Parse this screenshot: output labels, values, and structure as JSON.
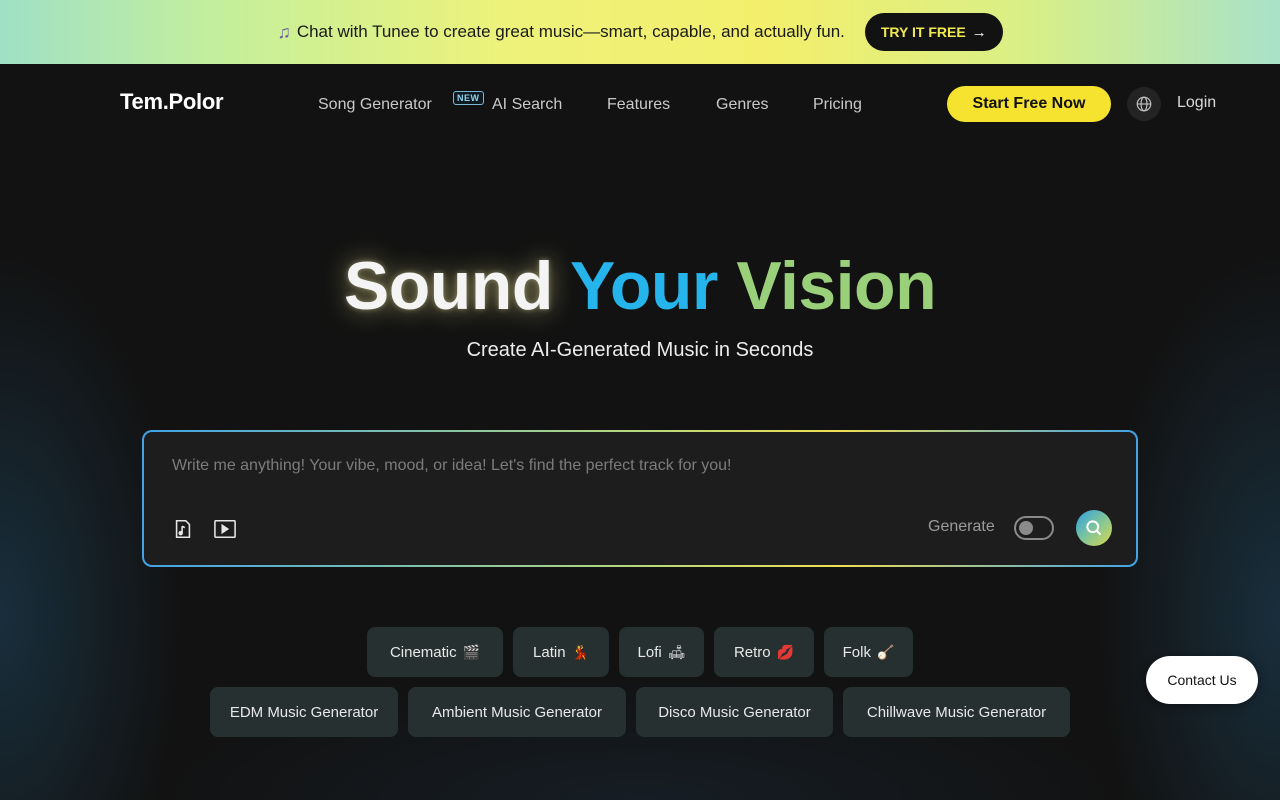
{
  "banner": {
    "text": "Chat with Tunee to create great music—smart, capable, and actually fun.",
    "cta": "TRY IT FREE",
    "arrow": "→"
  },
  "nav": {
    "logo": "Tem.Polor",
    "links": [
      "Song Generator",
      "AI Search",
      "Features",
      "Genres",
      "Pricing"
    ],
    "badge": "NEW",
    "start_label": "Start Free Now",
    "login_label": "Login"
  },
  "hero": {
    "title_part1": "Sound",
    "title_part2": "Your",
    "title_part3": "Vision",
    "subtitle": "Create AI-Generated Music in Seconds"
  },
  "prompt": {
    "placeholder": "Write me anything! Your vibe, mood, or idea! Let's find the perfect track for you!",
    "generate_label": "Generate",
    "generate_enabled": false
  },
  "genre_chips": [
    {
      "label": "Cinematic",
      "emoji": "🎬"
    },
    {
      "label": "Latin",
      "emoji": "💃"
    },
    {
      "label": "Lofi",
      "emoji": "🛋"
    },
    {
      "label": "Retro",
      "emoji": "💋"
    },
    {
      "label": "Folk",
      "emoji": "🪕"
    }
  ],
  "generator_chips": [
    "EDM Music Generator",
    "Ambient Music Generator",
    "Disco Music Generator",
    "Chillwave Music Generator"
  ],
  "contact_label": "Contact Us",
  "colors": {
    "accent_yellow": "#f6e330",
    "accent_blue": "#26b4ec",
    "accent_green": "#9ad07a",
    "background": "#121212",
    "chip_bg": "#263030"
  },
  "icons": [
    "music-note-icon",
    "arrow-right-icon",
    "globe-icon",
    "music-file-icon",
    "video-play-icon",
    "search-icon"
  ]
}
